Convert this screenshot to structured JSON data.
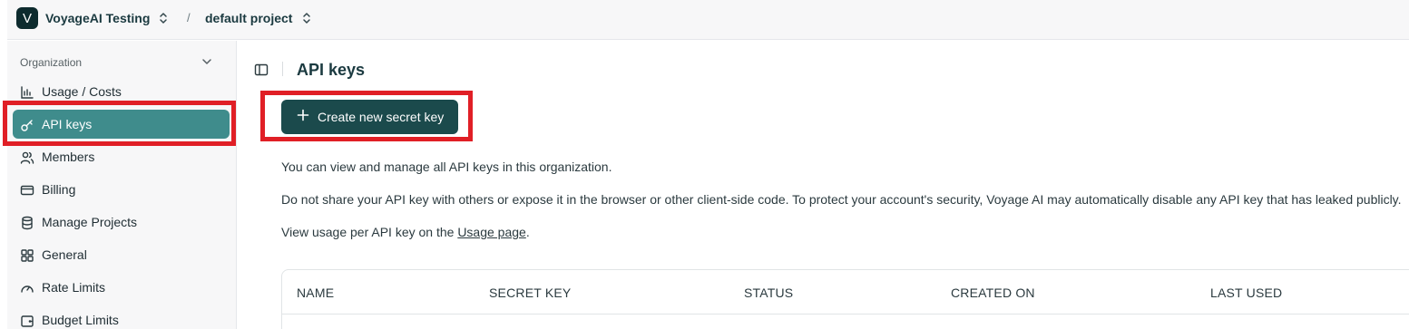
{
  "topbar": {
    "org_initial": "V",
    "org_name": "VoyageAI Testing",
    "separator": "/",
    "project_name": "default project"
  },
  "sidebar": {
    "section_label": "Organization",
    "items": [
      {
        "label": "Usage / Costs",
        "icon": "bar-chart-icon"
      },
      {
        "label": "API keys",
        "icon": "key-icon",
        "active": true
      },
      {
        "label": "Members",
        "icon": "users-icon"
      },
      {
        "label": "Billing",
        "icon": "credit-card-icon"
      },
      {
        "label": "Manage Projects",
        "icon": "database-icon"
      },
      {
        "label": "General",
        "icon": "grid-icon"
      },
      {
        "label": "Rate Limits",
        "icon": "gauge-icon"
      },
      {
        "label": "Budget Limits",
        "icon": "wallet-icon"
      }
    ]
  },
  "main": {
    "title": "API keys",
    "create_button": "Create new secret key",
    "para1": "You can view and manage all API keys in this organization.",
    "para2": "Do not share your API key with others or expose it in the browser or other client-side code. To protect your account's security, Voyage AI may automatically disable any API key that has leaked publicly.",
    "para3_prefix": "View usage per API key on the ",
    "para3_link": "Usage page",
    "para3_suffix": ".",
    "table": {
      "columns": [
        "NAME",
        "SECRET KEY",
        "STATUS",
        "CREATED ON",
        "LAST USED"
      ]
    }
  },
  "colors": {
    "accent": "#3f8c8c",
    "button": "#1b4a4c",
    "highlight": "#e01f26"
  }
}
